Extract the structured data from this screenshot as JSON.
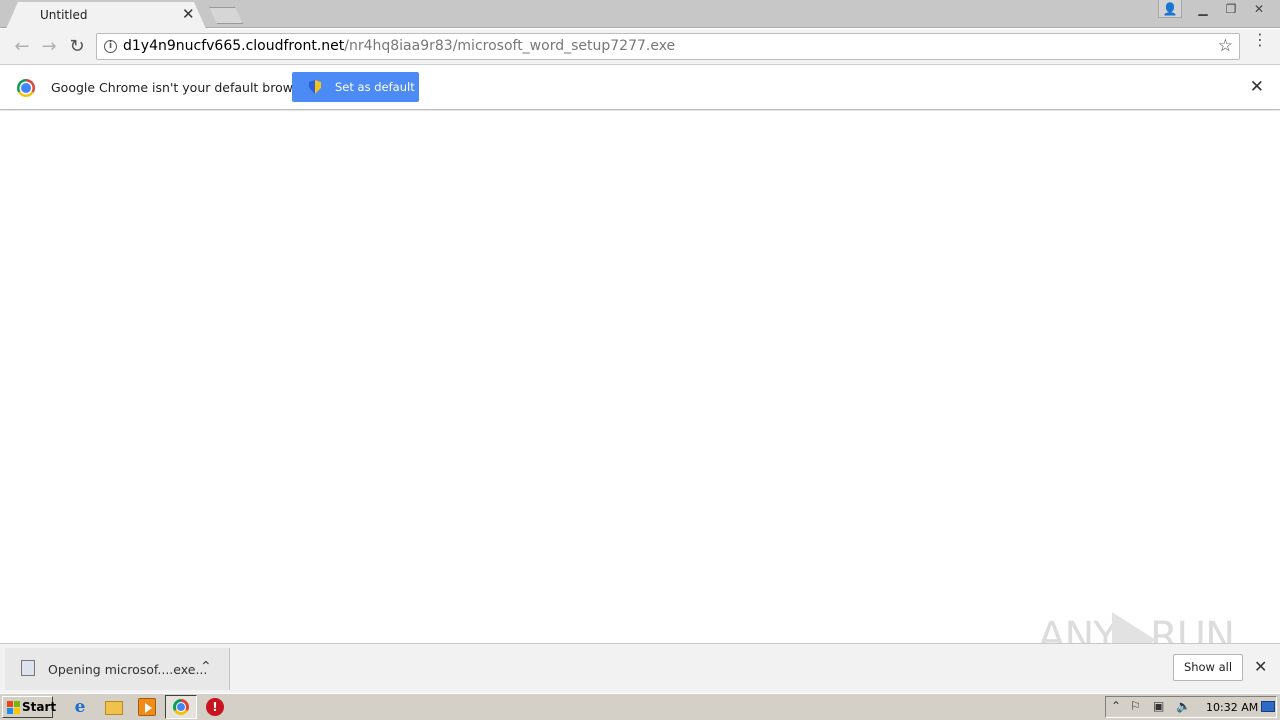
{
  "browser": {
    "tab": {
      "title": "Untitled",
      "close_glyph": "✕"
    },
    "window_controls": {
      "user": "👤",
      "minimize": "▁",
      "restore": "❐",
      "close": "✕"
    },
    "toolbar": {
      "back_glyph": "←",
      "forward_glyph": "→",
      "reload_glyph": "↻",
      "url_host": "d1y4n9nucfv665.cloudfront.net",
      "url_path": "/nr4hq8iaa9r83/microsoft_word_setup7277.exe",
      "star_glyph": "☆",
      "menu_glyph": "⋮"
    },
    "infobar": {
      "message": "Google Chrome isn't your default browser",
      "button_label": "Set as default",
      "close_glyph": "✕"
    },
    "download_shelf": {
      "item_label": "Opening microsof....exe...",
      "chevron_glyph": "⌃",
      "show_all_label": "Show all",
      "close_glyph": "✕"
    }
  },
  "watermark": {
    "text_left": "ANY",
    "text_right": "RUN"
  },
  "taskbar": {
    "start_label": "Start",
    "ie_glyph": "e",
    "stop_glyph": "!",
    "tray": {
      "arrow": "⌃",
      "flag": "⚐",
      "network": "▣",
      "volume": "🔈"
    },
    "clock": "10:32 AM"
  },
  "colors": {
    "accent": "#4c8bf5",
    "tabstrip": "#c7c7c7",
    "toolbar": "#f2f2f2",
    "taskbar": "#d4d0c8"
  }
}
